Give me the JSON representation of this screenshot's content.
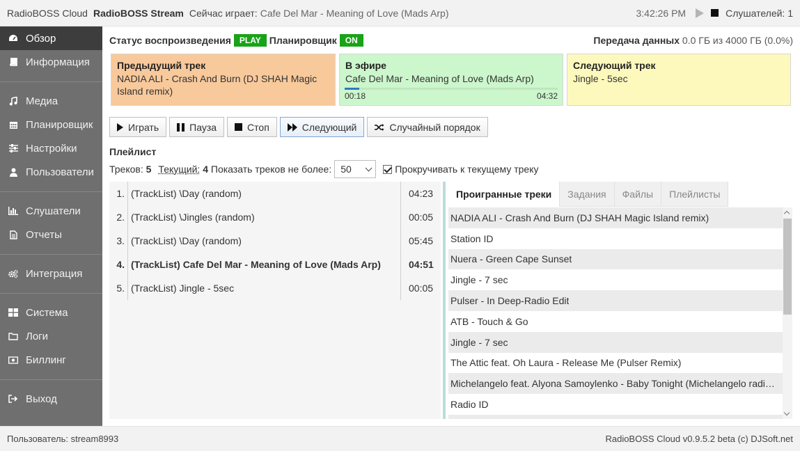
{
  "header": {
    "app_name": "RadioBOSS Cloud",
    "stream_name": "RadioBOSS Stream",
    "now_playing_label": "Сейчас играет:",
    "now_playing": "Cafe Del Mar - Meaning of Love (Mads Arp)",
    "clock": "3:42:26 PM",
    "listeners_label": "Слушателей: 1"
  },
  "sidebar": {
    "items": [
      {
        "label": "Обзор",
        "icon": "dashboard-icon"
      },
      {
        "label": "Информация",
        "icon": "book-icon"
      },
      {
        "label": "Медиа",
        "icon": "music-icon"
      },
      {
        "label": "Планировщик",
        "icon": "calendar-icon"
      },
      {
        "label": "Настройки",
        "icon": "sliders-icon"
      },
      {
        "label": "Пользователи",
        "icon": "user-icon"
      },
      {
        "label": "Слушатели",
        "icon": "bar-chart-icon"
      },
      {
        "label": "Отчеты",
        "icon": "document-icon"
      },
      {
        "label": "Интеграция",
        "icon": "gears-icon"
      },
      {
        "label": "Система",
        "icon": "grid-icon"
      },
      {
        "label": "Логи",
        "icon": "folder-icon"
      },
      {
        "label": "Биллинг",
        "icon": "money-icon"
      },
      {
        "label": "Выход",
        "icon": "sign-out-icon"
      }
    ]
  },
  "status": {
    "playback_label": "Статус воспроизведения",
    "playback_badge": "PLAY",
    "scheduler_label": "Планировщик",
    "scheduler_badge": "ON",
    "transfer_label": "Передача данных",
    "transfer_value": "0.0 ГБ из 4000 ГБ (0.0%)",
    "badge_color": "#18a318"
  },
  "panels": {
    "prev": {
      "title": "Предыдущий трек",
      "track": "NADIA ALI - Crash And Burn (DJ SHAH Magic Island remix)",
      "color": "#f8c99b"
    },
    "current": {
      "title": "В эфире",
      "track": "Cafe Del Mar - Meaning of Love (Mads Arp)",
      "elapsed": "00:18",
      "duration": "04:32",
      "progress": 0.07,
      "color": "#ccf6cc"
    },
    "next": {
      "title": "Следующий трек",
      "track": "Jingle - 5sec",
      "color": "#fdf9bd"
    }
  },
  "controls": {
    "play": "Играть",
    "pause": "Пауза",
    "stop": "Стоп",
    "next": "Следующий",
    "shuffle": "Случайный порядок"
  },
  "playlist": {
    "title": "Плейлист",
    "tracks_label": "Треков:",
    "tracks_count": "5",
    "current_label": "Текущий:",
    "current_index": "4",
    "show_label": "Показать треков не более:",
    "show_value": "50",
    "scroll_label": "Прокручивать к текущему треку",
    "rows": [
      {
        "num": "1.",
        "name": "(TrackList) \\Day (random)",
        "dur": "04:23"
      },
      {
        "num": "2.",
        "name": "(TrackList) \\Jingles (random)",
        "dur": "00:05"
      },
      {
        "num": "3.",
        "name": "(TrackList) \\Day (random)",
        "dur": "05:45"
      },
      {
        "num": "4.",
        "name": "(TrackList) Cafe Del Mar - Meaning of Love (Mads Arp)",
        "dur": "04:51"
      },
      {
        "num": "5.",
        "name": "(TrackList) Jingle - 5sec",
        "dur": "00:05"
      }
    ]
  },
  "tabs": {
    "items": [
      "Проигранные треки",
      "Задания",
      "Файлы",
      "Плейлисты"
    ],
    "history": [
      "NADIA ALI - Crash And Burn (DJ SHAH Magic Island remix)",
      "Station ID",
      "Nuera - Green Cape Sunset",
      "Jingle - 7 sec",
      "Pulser - In Deep-Radio Edit",
      "ATB - Touch & Go",
      "Jingle - 7 sec",
      "The Attic feat. Oh Laura - Release Me (Pulser Remix)",
      "Michelangelo feat. Alyona Samoylenko - Baby Tonight (Michelangelo radio mix)",
      "Radio ID"
    ]
  },
  "footer": {
    "user": "Пользователь: stream8993",
    "version": "RadioBOSS Cloud v0.9.5.2 beta (c) DJSoft.net"
  }
}
